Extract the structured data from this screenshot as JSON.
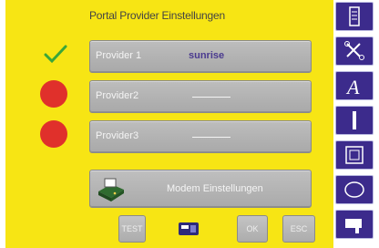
{
  "title": "Portal Provider Einstellungen",
  "providers": [
    {
      "label": "Provider 1",
      "value": "sunrise",
      "status": "active"
    },
    {
      "label": "Provider2",
      "value": "_____",
      "status": "inactive"
    },
    {
      "label": "Provider3",
      "value": "_____",
      "status": "inactive"
    }
  ],
  "modem": {
    "label": "Modem Einstellungen"
  },
  "bottom": {
    "prev_label": "TEST",
    "ok_label": "OK",
    "esc_label": "ESC"
  },
  "colors": {
    "background": "#f7e514",
    "status_inactive": "#e0302b",
    "status_active": "#3aa63a",
    "sidebar": "#3c2b8c"
  },
  "sidebar_icons": [
    "file-icon",
    "scissors-icon",
    "letter-a-icon",
    "stitch-icon",
    "frame-icon",
    "oval-icon",
    "flag-icon"
  ]
}
